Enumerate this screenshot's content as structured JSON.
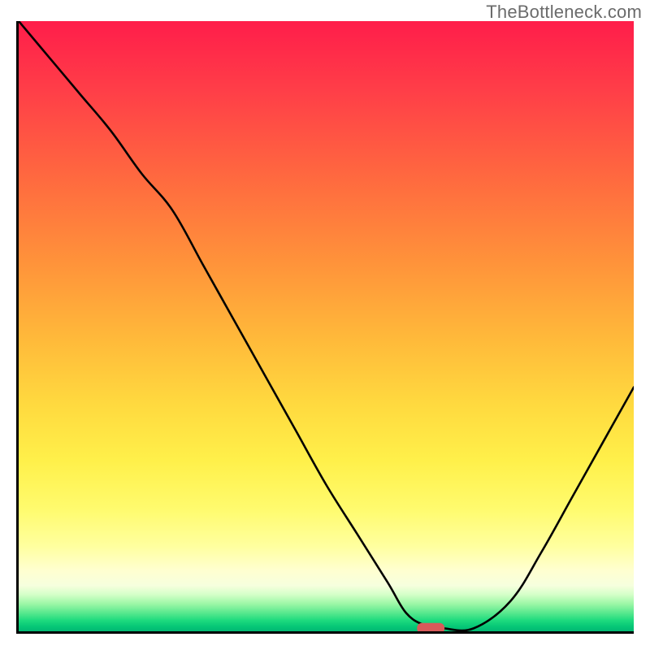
{
  "attribution": "TheBottleneck.com",
  "chart_data": {
    "type": "line",
    "title": "",
    "xlabel": "",
    "ylabel": "",
    "xlim": [
      0,
      100
    ],
    "ylim": [
      0,
      100
    ],
    "grid": false,
    "series": [
      {
        "name": "bottleneck-curve",
        "x": [
          0,
          5,
          10,
          15,
          20,
          25,
          30,
          35,
          40,
          45,
          50,
          55,
          60,
          63,
          66,
          69,
          74,
          80,
          85,
          90,
          95,
          100
        ],
        "y": [
          100,
          94,
          88,
          82,
          75,
          69,
          60,
          51,
          42,
          33,
          24,
          16,
          8,
          3,
          1,
          0.5,
          0.5,
          5,
          13,
          22,
          31,
          40
        ]
      }
    ],
    "background_gradient": {
      "orientation": "vertical",
      "stops": [
        {
          "pos": 0.0,
          "color": "#ff1d4a"
        },
        {
          "pos": 0.26,
          "color": "#ff6a3f"
        },
        {
          "pos": 0.52,
          "color": "#ffb93a"
        },
        {
          "pos": 0.72,
          "color": "#fff04a"
        },
        {
          "pos": 0.9,
          "color": "#ffffd0"
        },
        {
          "pos": 0.96,
          "color": "#57e88e"
        },
        {
          "pos": 1.0,
          "color": "#02b873"
        }
      ]
    },
    "optimum_marker": {
      "x": 67,
      "y": 0.5,
      "color": "#d85a5a"
    }
  }
}
